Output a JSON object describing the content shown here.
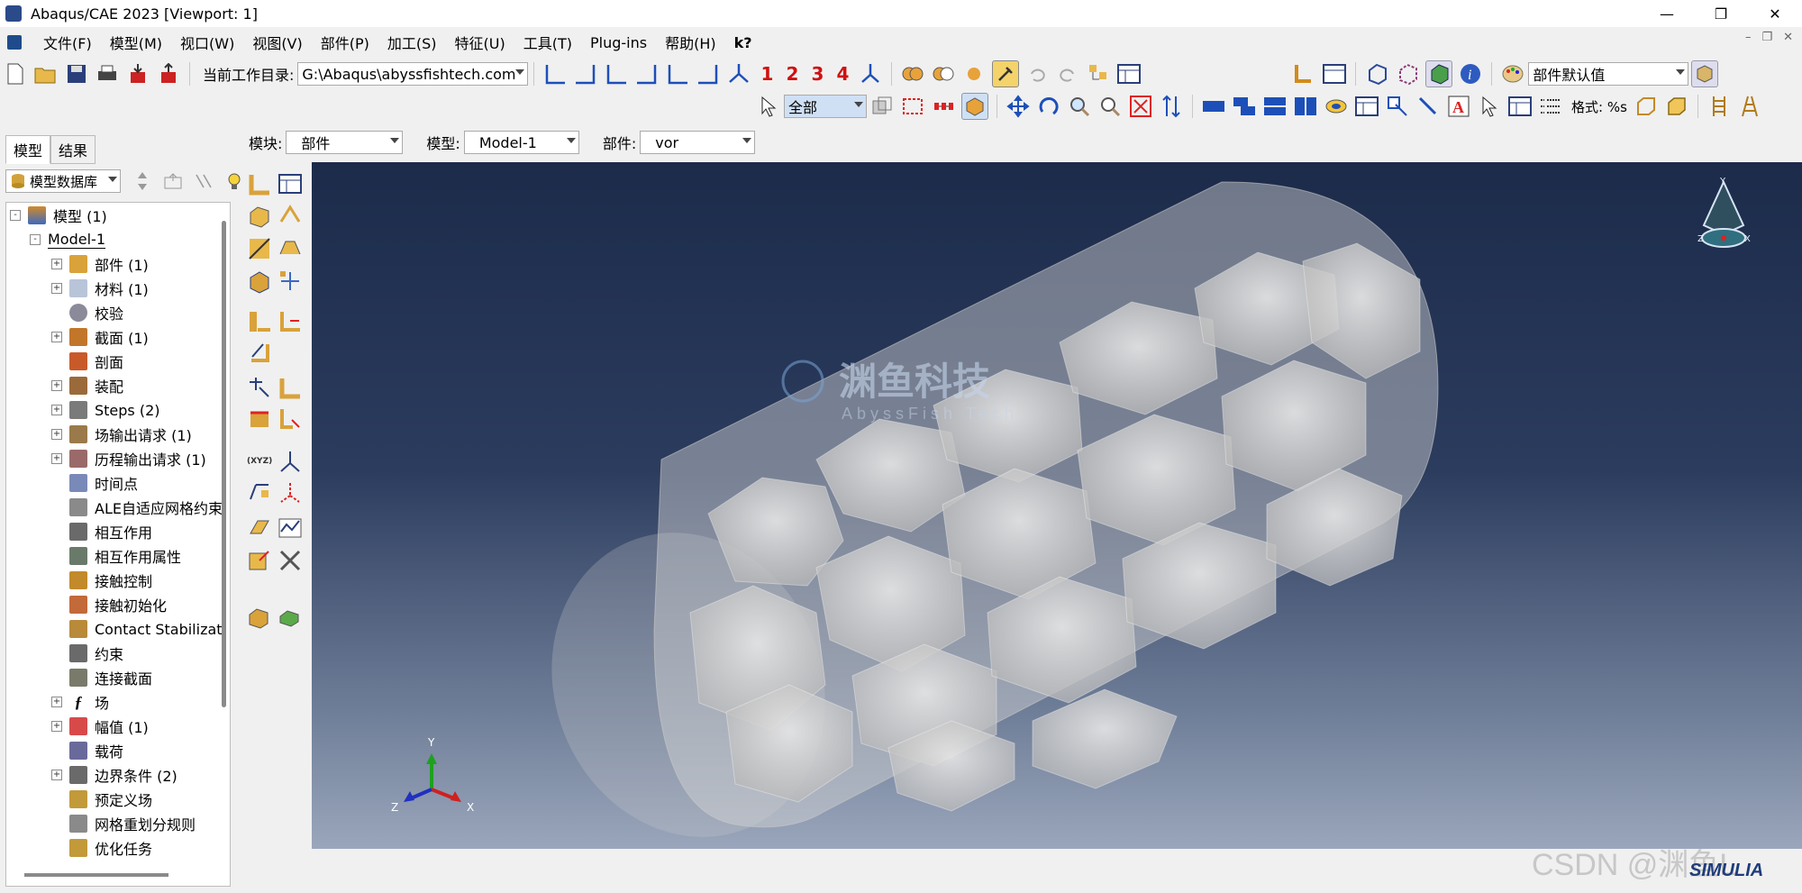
{
  "window": {
    "title": "Abaqus/CAE 2023 [Viewport: 1]",
    "min": "—",
    "max": "❐",
    "close": "✕"
  },
  "menu": [
    "文件(F)",
    "模型(M)",
    "视口(W)",
    "视图(V)",
    "部件(P)",
    "加工(S)",
    "特征(U)",
    "工具(T)",
    "Plug-ins",
    "帮助(H)",
    "k?"
  ],
  "toolbar": {
    "workdir_label": "当前工作目录:",
    "workdir_value": "G:\\Abaqus\\abyssfishtech.com",
    "viewport_numbers": [
      "1",
      "2",
      "3",
      "4"
    ],
    "render_style": "部件默认值"
  },
  "toolbar2": {
    "select_filter": "全部",
    "format_label": "格式: %s"
  },
  "context": {
    "module_label": "模块:",
    "module_value": "部件",
    "model_label": "模型:",
    "model_value": "Model-1",
    "part_label": "部件:",
    "part_value": "vor"
  },
  "tabs": [
    "模型",
    "结果"
  ],
  "tree_toolbar": {
    "db_select": "模型数据库"
  },
  "tree": [
    {
      "label": "模型 (1)",
      "level": 0,
      "exp": "-"
    },
    {
      "label": "Model-1",
      "level": 1,
      "exp": "-"
    },
    {
      "label": "部件 (1)",
      "level": 2,
      "exp": "+"
    },
    {
      "label": "材料 (1)",
      "level": 2,
      "exp": "+"
    },
    {
      "label": "校验",
      "level": 2,
      "exp": ""
    },
    {
      "label": "截面 (1)",
      "level": 2,
      "exp": "+"
    },
    {
      "label": "剖面",
      "level": 2,
      "exp": ""
    },
    {
      "label": "装配",
      "level": 2,
      "exp": "+"
    },
    {
      "label": "Steps (2)",
      "level": 2,
      "exp": "+"
    },
    {
      "label": "场输出请求 (1)",
      "level": 2,
      "exp": "+"
    },
    {
      "label": "历程输出请求 (1)",
      "level": 2,
      "exp": "+"
    },
    {
      "label": "时间点",
      "level": 2,
      "exp": ""
    },
    {
      "label": "ALE自适应网格约束",
      "level": 2,
      "exp": ""
    },
    {
      "label": "相互作用",
      "level": 2,
      "exp": ""
    },
    {
      "label": "相互作用属性",
      "level": 2,
      "exp": ""
    },
    {
      "label": "接触控制",
      "level": 2,
      "exp": ""
    },
    {
      "label": "接触初始化",
      "level": 2,
      "exp": ""
    },
    {
      "label": "Contact Stabilizati",
      "level": 2,
      "exp": ""
    },
    {
      "label": "约束",
      "level": 2,
      "exp": ""
    },
    {
      "label": "连接截面",
      "level": 2,
      "exp": ""
    },
    {
      "label": "场",
      "level": 2,
      "exp": "+"
    },
    {
      "label": "幅值 (1)",
      "level": 2,
      "exp": "+"
    },
    {
      "label": "载荷",
      "level": 2,
      "exp": ""
    },
    {
      "label": "边界条件 (2)",
      "level": 2,
      "exp": "+"
    },
    {
      "label": "预定义场",
      "level": 2,
      "exp": ""
    },
    {
      "label": "网格重划分规则",
      "level": 2,
      "exp": ""
    },
    {
      "label": "优化任务",
      "level": 2,
      "exp": ""
    }
  ],
  "viewport": {
    "watermark_cn": "渊鱼科技",
    "watermark_en": "AbyssFish Tech",
    "triad": {
      "x": "X",
      "y": "Y",
      "z": "Z"
    },
    "compass": {
      "y": "Y",
      "x": "X",
      "z": "Z"
    }
  },
  "footer": {
    "watermark": "CSDN @渊鱼L",
    "logo": "SIMULIA"
  },
  "colors": {
    "viewport_top": "#1c2b4a",
    "viewport_bottom": "#9aa6bb",
    "axis_x": "#d02020",
    "axis_y": "#20a020",
    "axis_z": "#2030c0"
  }
}
